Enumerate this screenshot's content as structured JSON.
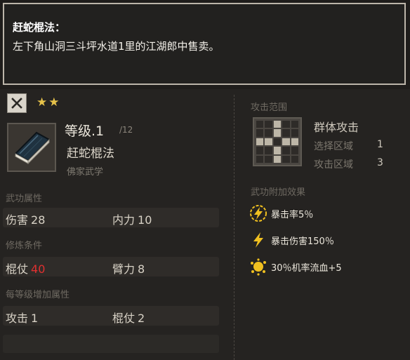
{
  "tooltip": {
    "title": "赶蛇棍法：",
    "body": "左下角山洞三斗坪水道1里的江湖郎中售卖。"
  },
  "header": {
    "stars": "★★",
    "level_label": "等级.1",
    "level_max": "/12",
    "skill_name": "赶蛇棍法",
    "skill_type": "佛家武学"
  },
  "attributes": {
    "title": "武功属性",
    "items": [
      {
        "label": "伤害",
        "value": "28"
      },
      {
        "label": "内力",
        "value": "10"
      }
    ]
  },
  "requirements": {
    "title": "修炼条件",
    "items": [
      {
        "label": "棍仗",
        "value": "40",
        "unmet": true
      },
      {
        "label": "臂力",
        "value": "8",
        "unmet": false
      }
    ]
  },
  "per_level": {
    "title": "每等级增加属性",
    "items": [
      {
        "label": "攻击",
        "value": "1"
      },
      {
        "label": "棍仗",
        "value": "2"
      }
    ]
  },
  "range": {
    "title": "攻击范围",
    "attack_type": "群体攻击",
    "select_label": "选择区域",
    "select_value": "1",
    "attack_label": "攻击区域",
    "attack_value": "3"
  },
  "effects": {
    "title": "武功附加效果",
    "items": [
      {
        "icon": "lightning-badge-icon",
        "text": "暴击率5％"
      },
      {
        "icon": "lightning-icon",
        "text": "暴击伤害150％"
      },
      {
        "icon": "blood-splash-icon",
        "text": "30％机率流血+5"
      }
    ]
  },
  "colors": {
    "accent_gold": "#e6c24a",
    "unmet_red": "#e03030",
    "effect_icon": "#f0c020"
  }
}
